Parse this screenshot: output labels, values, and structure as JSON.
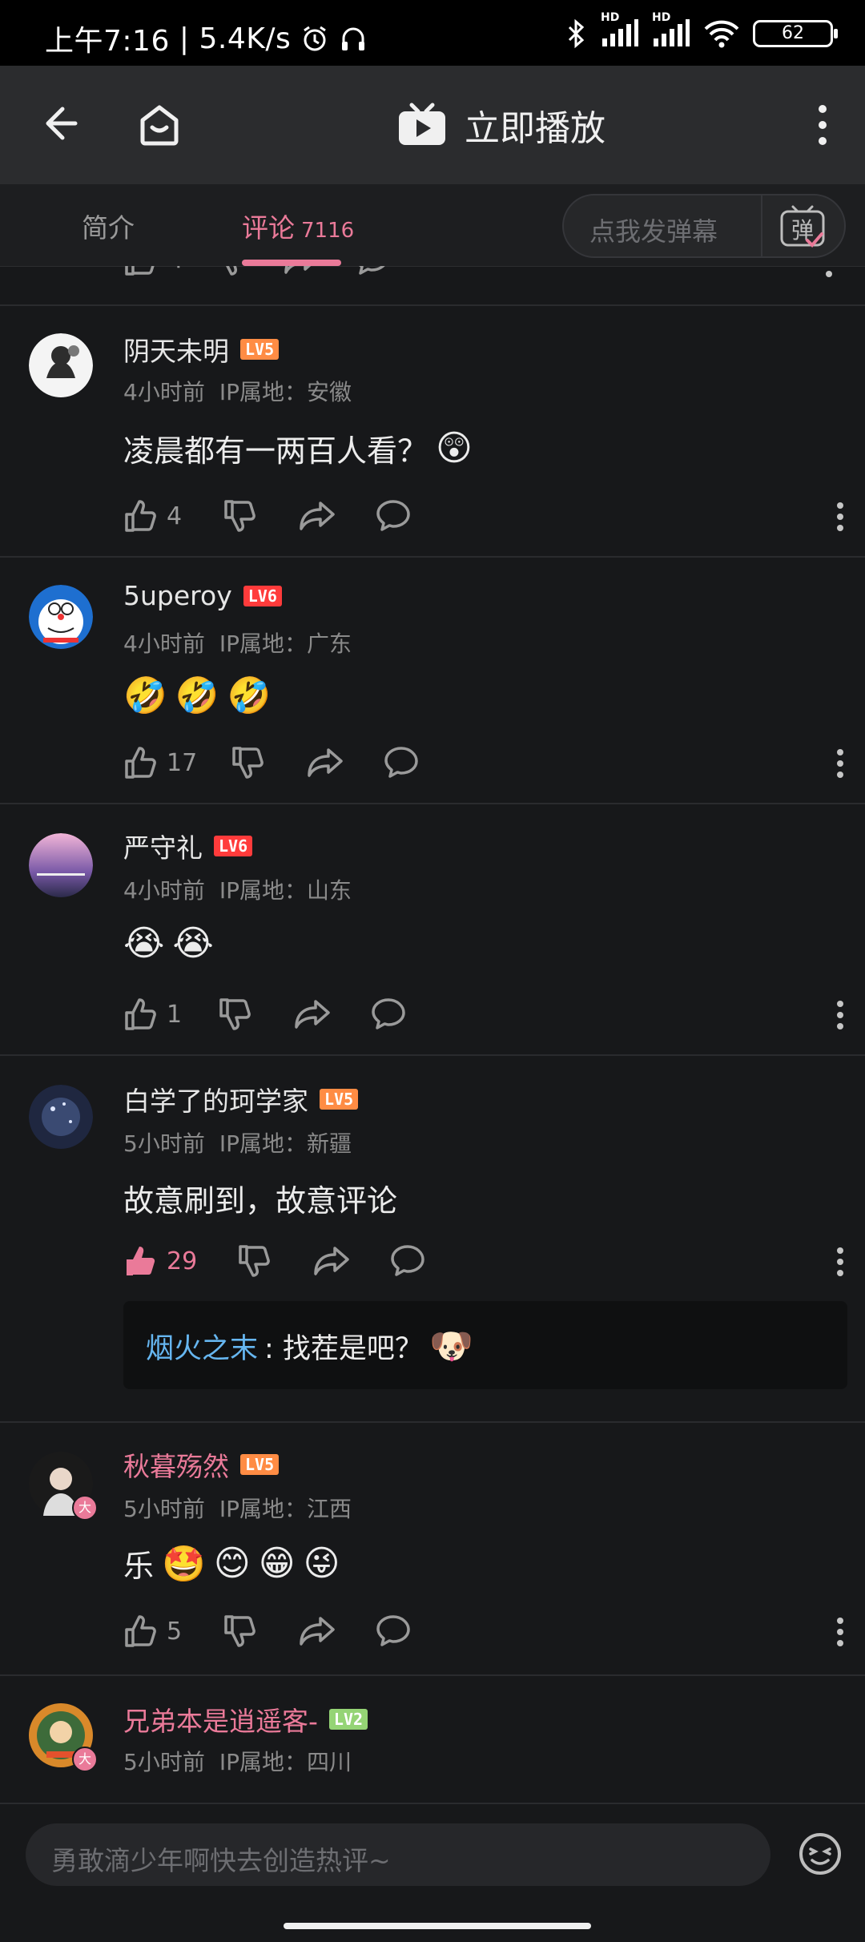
{
  "status_bar": {
    "time": "上午7:16",
    "speed": "5.4K/s",
    "battery": "62",
    "hd1": "HD",
    "hd2": "HD"
  },
  "topnav": {
    "title": "立即播放"
  },
  "tabs": {
    "intro": "简介",
    "comments": "评论",
    "comments_count": "7116",
    "danmaku_placeholder": "点我发弹幕",
    "danmaku_icon_char": "弹"
  },
  "partial_comment": {
    "likes": "4"
  },
  "comments": [
    {
      "user": "阴天未明",
      "level": "LV5",
      "time": "4小时前",
      "ip": "IP属地：安徽",
      "text": "凌晨都有一两百人看？",
      "emojis": [
        "😲"
      ],
      "likes": "4",
      "liked": false
    },
    {
      "user": "5uperoy",
      "level": "LV6",
      "time": "4小时前",
      "ip": "IP属地：广东",
      "text": "",
      "emojis": [
        "🤣",
        "🤣",
        "🤣"
      ],
      "likes": "17",
      "liked": false
    },
    {
      "user": "严守礼",
      "level": "LV6",
      "time": "4小时前",
      "ip": "IP属地：山东",
      "text": "",
      "emojis": [
        "😭",
        "😭"
      ],
      "likes": "1",
      "liked": false
    },
    {
      "user": "白学了的珂学家",
      "level": "LV5",
      "time": "5小时前",
      "ip": "IP属地：新疆",
      "text": "故意刷到，故意评论",
      "emojis": [],
      "likes": "29",
      "liked": true,
      "reply": {
        "user": "烟火之末",
        "text": ": 找茬是吧？",
        "emoji": "🐶"
      }
    },
    {
      "user": "秋暮殇然",
      "level": "LV5",
      "time": "5小时前",
      "ip": "IP属地：江西",
      "text": "乐",
      "emojis": [
        "🤩",
        "😊",
        "😁",
        "😜"
      ],
      "likes": "5",
      "liked": false,
      "badge": "大"
    },
    {
      "user": "兄弟本是逍遥客-",
      "level": "LV2",
      "time": "5小时前",
      "ip": "IP属地：四川",
      "badge": "大"
    }
  ],
  "bottom": {
    "placeholder": "勇敢滴少年啊快去创造热评~"
  },
  "colors": {
    "accent_pink": "#ea7a99",
    "reply_blue": "#66b6f0",
    "bg": "#17181a"
  },
  "icons": [
    "back-icon",
    "home-icon",
    "tv-play-icon",
    "more-icon",
    "danmaku-icon",
    "like-icon",
    "dislike-icon",
    "share-icon",
    "comment-icon",
    "emoji-icon",
    "bluetooth-icon",
    "signal-icon",
    "wifi-icon",
    "alarm-icon",
    "headphone-icon"
  ]
}
